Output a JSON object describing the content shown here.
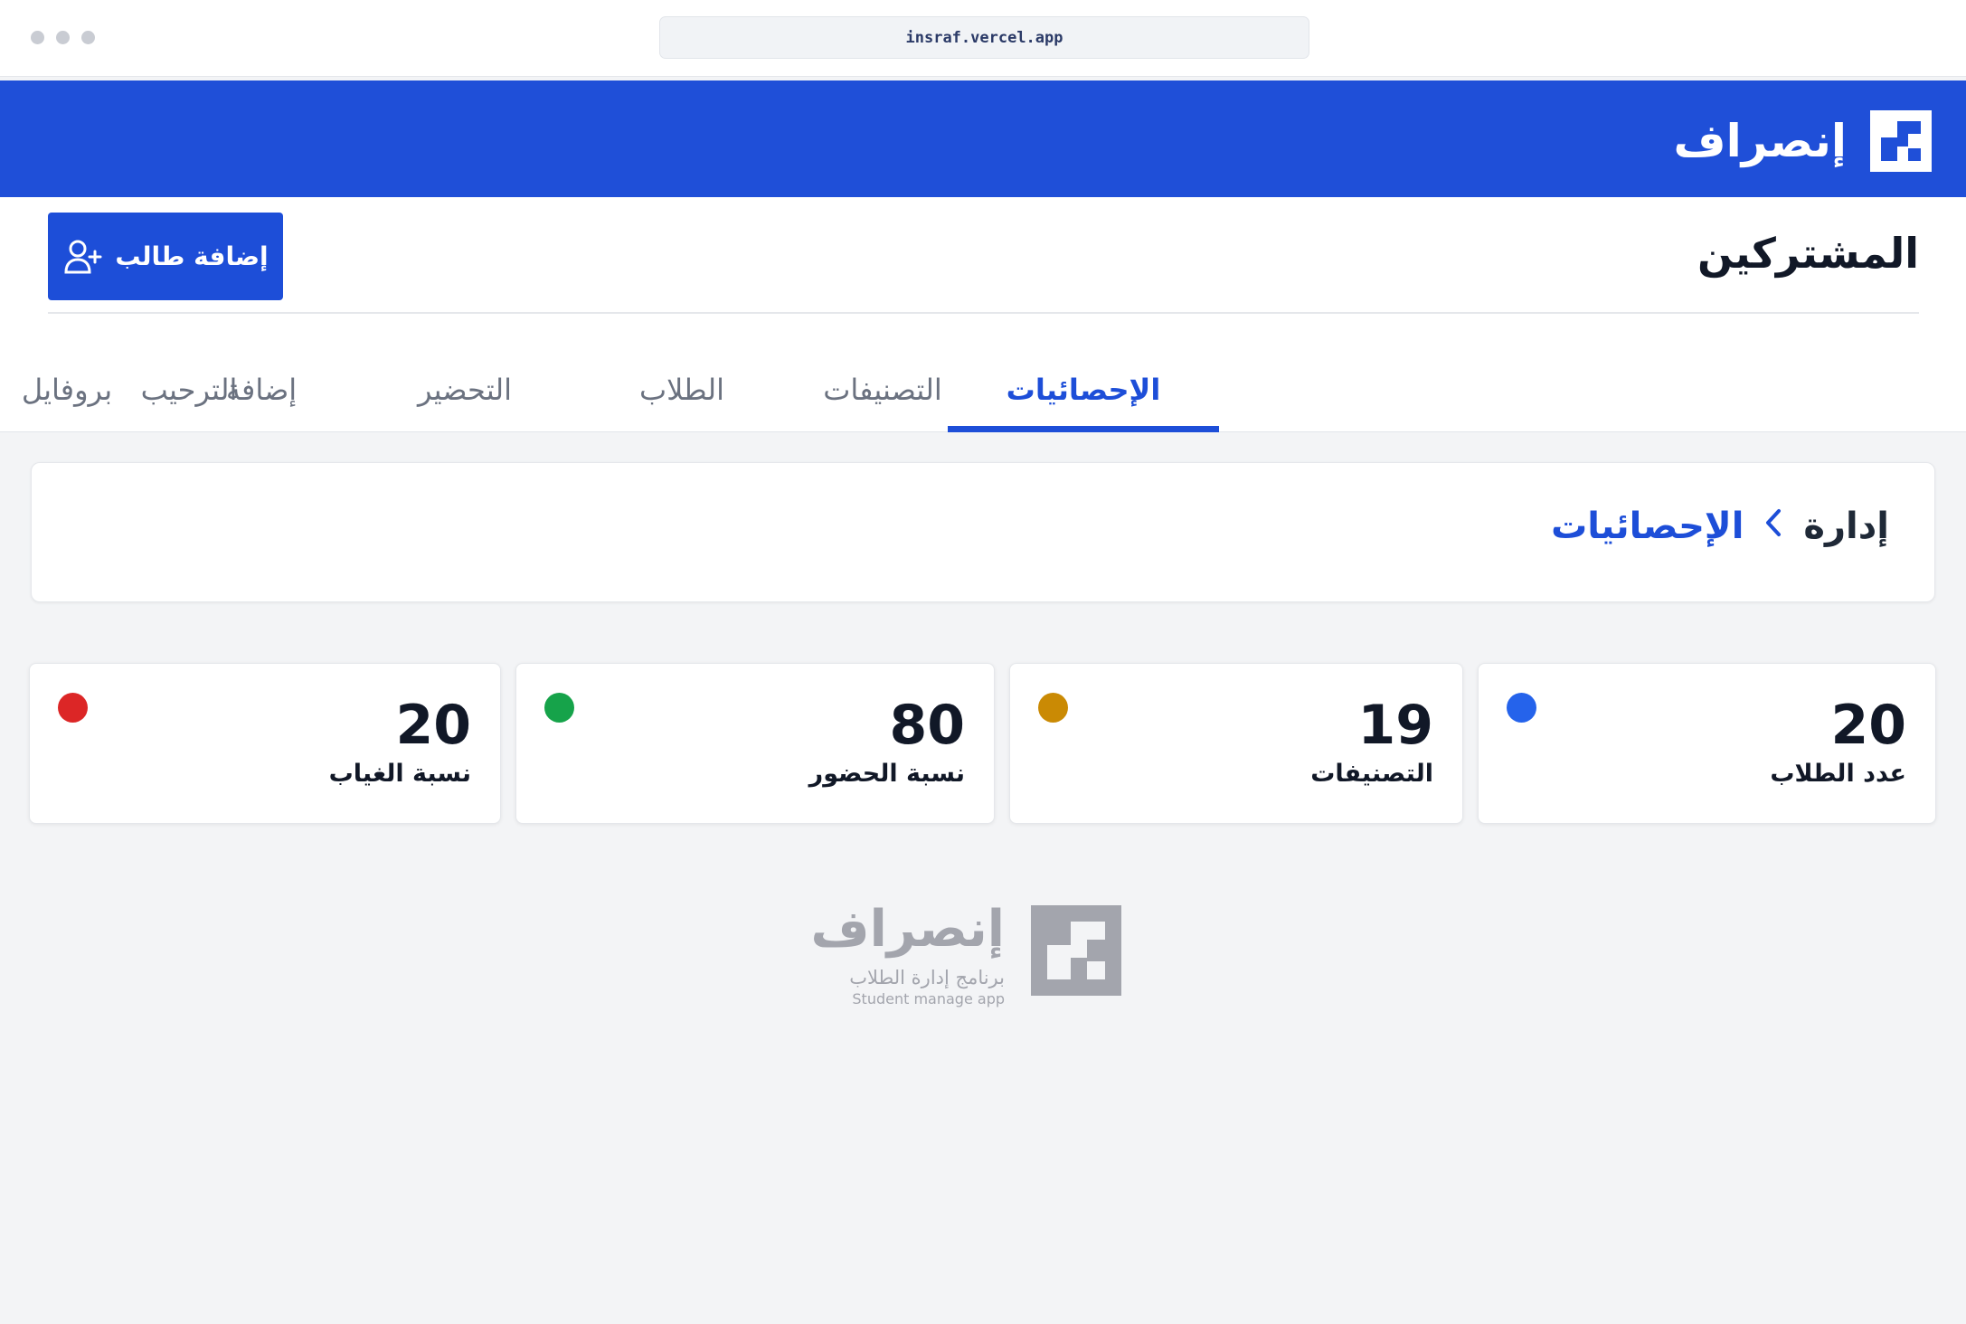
{
  "browser": {
    "url": "insraf.vercel.app"
  },
  "navbar": {
    "brand": "إنصراف",
    "logo_icon": "insraf-logo-icon"
  },
  "header": {
    "title": "المشتركين",
    "add_button_label": "إضافة طالب",
    "add_button_icon": "user-plus-icon"
  },
  "tabs": [
    {
      "label": "الترحيب",
      "active": false
    },
    {
      "label": "الإحصائيات",
      "active": true
    },
    {
      "label": "التصنيفات",
      "active": false
    },
    {
      "label": "الطلاب",
      "active": false
    },
    {
      "label": "التحضير",
      "active": false
    },
    {
      "label": "إضافة",
      "active": false
    },
    {
      "label": "بروفايل",
      "active": false
    }
  ],
  "breadcrumb": {
    "root": "إدارة",
    "current": "الإحصائيات",
    "separator_icon": "chevron-left-icon"
  },
  "stats": [
    {
      "value": "20",
      "label": "عدد الطلاب",
      "color": "#2563eb"
    },
    {
      "value": "19",
      "label": "التصنيفات",
      "color": "#ca8a04"
    },
    {
      "value": "80",
      "label": "نسبة الحضور",
      "color": "#16a34a"
    },
    {
      "value": "20",
      "label": "نسبة الغياب",
      "color": "#dc2626"
    }
  ],
  "footer": {
    "brand": "إنصراف",
    "subtitle": "برنامج إدارة الطلاب",
    "subtitle_en": "Student manage app"
  },
  "colors": {
    "primary": "#1d4ed8",
    "navbar": "#1f4fd8",
    "background": "#f3f4f6"
  }
}
